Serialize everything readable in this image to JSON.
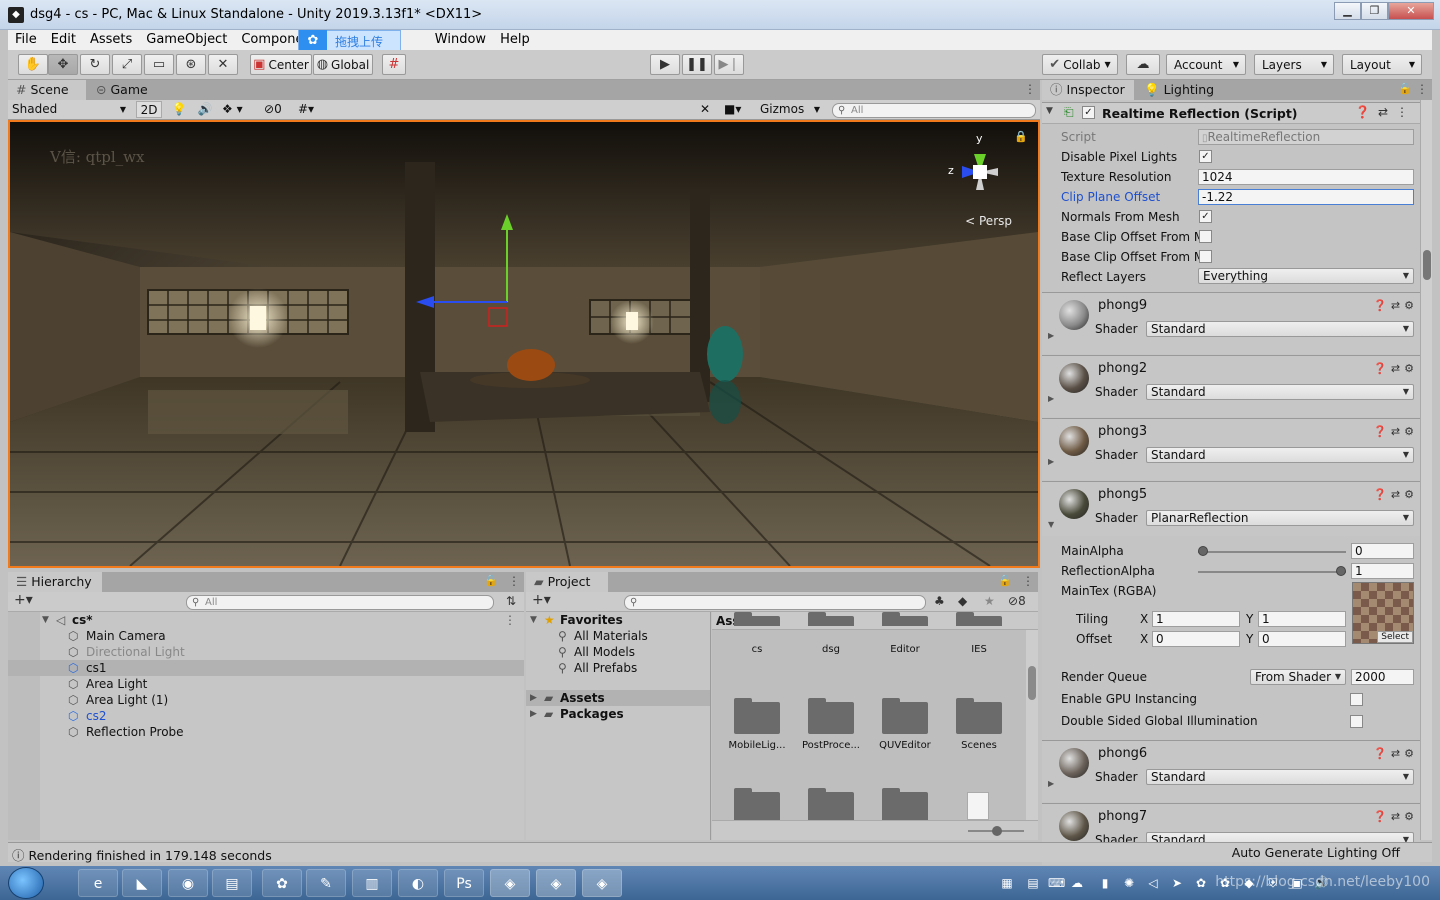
{
  "window": {
    "title": "dsg4 - cs - PC, Mac & Linux Standalone - Unity 2019.3.13f1* <DX11>",
    "buttons": [
      "▁",
      "❐",
      "✕"
    ]
  },
  "menu": {
    "items": [
      "File",
      "Edit",
      "Assets",
      "GameObject",
      "Component"
    ],
    "items_after": [
      "Window",
      "Help"
    ],
    "upload_label": "拖拽上传"
  },
  "toolbar": {
    "center_label": "Center",
    "global_label": "Global",
    "collab_label": "Collab",
    "account_label": "Account",
    "layers_label": "Layers",
    "layout_label": "Layout"
  },
  "scene": {
    "tab_scene": "Scene",
    "tab_game": "Game",
    "shading_mode": "Shaded",
    "mode_2d": "2D",
    "hidden_count": "0",
    "gizmos_label": "Gizmos",
    "search_placeholder": "All",
    "watermark": "V信: qtpl_wx",
    "gizmo_y": "y",
    "gizmo_z": "z",
    "persp_label": "Persp"
  },
  "hierarchy": {
    "tab_label": "Hierarchy",
    "search_placeholder": "All",
    "scene_name": "cs*",
    "items": [
      {
        "label": "Main Camera",
        "state": "normal"
      },
      {
        "label": "Directional Light",
        "state": "dim"
      },
      {
        "label": "cs1",
        "state": "selected"
      },
      {
        "label": "Area Light",
        "state": "normal"
      },
      {
        "label": "Area Light (1)",
        "state": "normal"
      },
      {
        "label": "cs2",
        "state": "blue"
      },
      {
        "label": "Reflection Probe",
        "state": "normal"
      }
    ]
  },
  "project": {
    "tab_label": "Project",
    "hidden_count": "8",
    "favorites_label": "Favorites",
    "favorites": [
      "All Materials",
      "All Models",
      "All Prefabs"
    ],
    "roots": [
      "Assets",
      "Packages"
    ],
    "assets_header": "Assets",
    "folders_row1": [
      "cs",
      "dsg",
      "Editor",
      "IES"
    ],
    "folders_row2": [
      "MobileLig...",
      "PostProce...",
      "QUVEditor",
      "Scenes"
    ]
  },
  "inspector": {
    "tab_inspector": "Inspector",
    "tab_lighting": "Lighting",
    "component_title": "Realtime Reflection (Script)",
    "props": {
      "script_label": "Script",
      "script_value": "RealtimeReflection",
      "disable_pixel_lights_label": "Disable Pixel Lights",
      "disable_pixel_lights": true,
      "texture_resolution_label": "Texture Resolution",
      "texture_resolution": "1024",
      "clip_plane_offset_label": "Clip Plane Offset",
      "clip_plane_offset": "-1.22",
      "normals_from_mesh_label": "Normals From Mesh",
      "normals_from_mesh": true,
      "base_clip_offset_1_label": "Base Clip Offset From M",
      "base_clip_offset_2_label": "Base Clip Offset From M",
      "reflect_layers_label": "Reflect Layers",
      "reflect_layers": "Everything"
    },
    "shader_label": "Shader",
    "materials": [
      {
        "name": "phong9",
        "shader": "Standard",
        "color": "#8a8a8a"
      },
      {
        "name": "phong2",
        "shader": "Standard",
        "color": "#5a5047"
      },
      {
        "name": "phong3",
        "shader": "Standard",
        "color": "#6e5a44"
      },
      {
        "name": "phong5",
        "shader": "PlanarReflection",
        "color": "#4a4a3a"
      }
    ],
    "planar": {
      "main_alpha_label": "MainAlpha",
      "main_alpha": "0",
      "main_alpha_level": 0,
      "reflection_alpha_label": "ReflectionAlpha",
      "reflection_alpha": "1",
      "reflection_alpha_level": 1,
      "maintex_label": "MainTex (RGBA)",
      "tiling_label": "Tiling",
      "offset_label": "Offset",
      "x_label": "X",
      "y_label": "Y",
      "tiling_x": "1",
      "tiling_y": "1",
      "offset_x": "0",
      "offset_y": "0",
      "select_label": "Select",
      "render_queue_label": "Render Queue",
      "render_queue_mode": "From Shader",
      "render_queue_value": "2000",
      "gpu_instancing_label": "Enable GPU Instancing",
      "double_sided_label": "Double Sided Global Illumination"
    },
    "materials_after": [
      {
        "name": "phong6",
        "shader": "Standard",
        "color": "#6b625a"
      },
      {
        "name": "phong7",
        "shader": "Standard",
        "color": "#5e5648"
      }
    ]
  },
  "status": {
    "message": "Rendering finished in 179.148 seconds",
    "right": "Auto Generate Lighting Off"
  },
  "taskbar": {
    "tray_text": "https://blog.csdn.net/leeby100"
  },
  "colors": {
    "viewport_border": "#f07a1c",
    "selection": "#b2b2b2",
    "link_blue": "#1d4fd0"
  }
}
